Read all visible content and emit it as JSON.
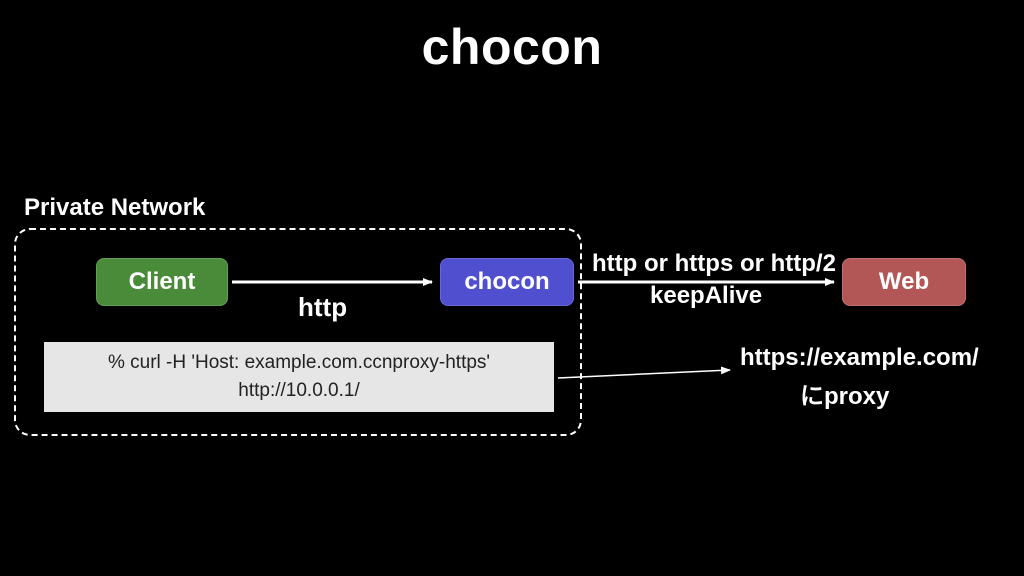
{
  "title": "chocon",
  "privateNetworkLabel": "Private Network",
  "nodes": {
    "client": "Client",
    "chocon": "chocon",
    "web": "Web"
  },
  "arrows": {
    "httpLabel": "http",
    "protocolLabel": "http or https or http/2",
    "keepAliveLabel": "keepAlive"
  },
  "curl": {
    "line1": "% curl  -H 'Host: example.com.ccnproxy-https'",
    "line2": "http://10.0.0.1/"
  },
  "proxy": {
    "target": "https://example.com/",
    "label": "にproxy"
  }
}
